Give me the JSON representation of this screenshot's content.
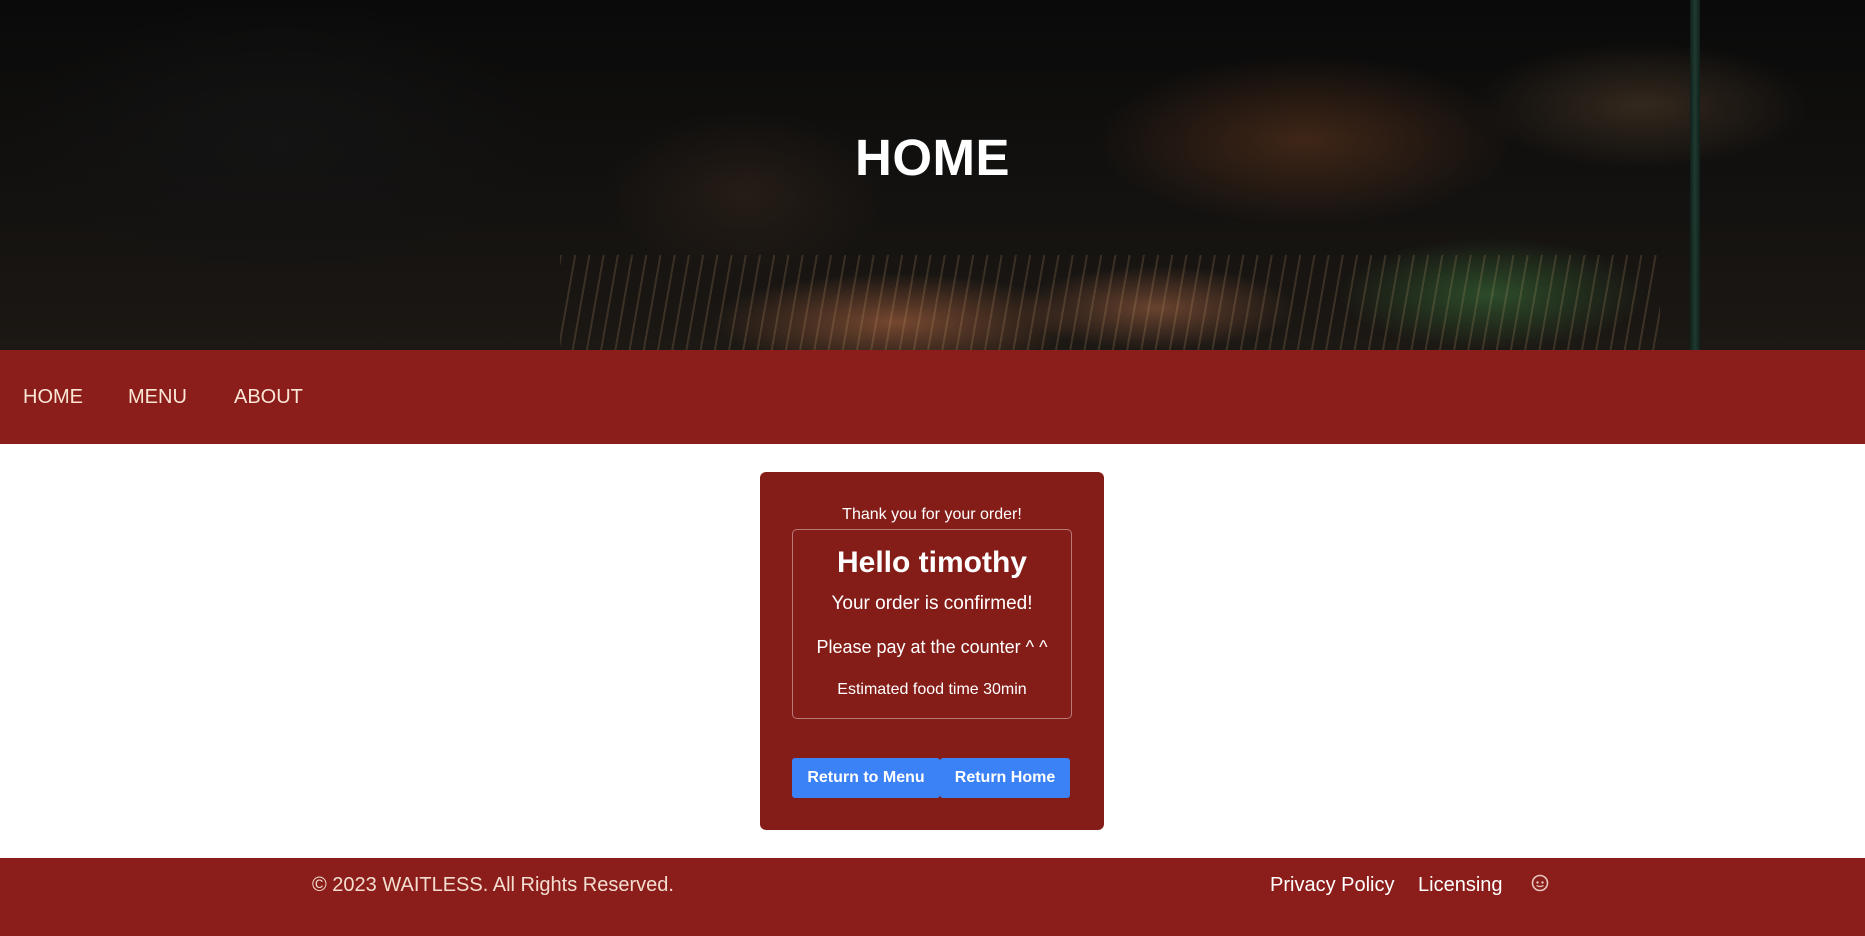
{
  "hero": {
    "title": "HOME"
  },
  "nav": {
    "items": [
      {
        "label": "HOME"
      },
      {
        "label": "MENU"
      },
      {
        "label": "ABOUT"
      }
    ]
  },
  "order": {
    "thanks": "Thank you for your order!",
    "greeting": "Hello timothy",
    "confirmed": "Your order is confirmed!",
    "pay_note": "Please pay at the counter ^ ^",
    "estimate": "Estimated food time 30min",
    "return_menu_label": "Return to Menu",
    "return_home_label": "Return Home"
  },
  "footer": {
    "copyright": "© 2023 WAITLESS. All Rights Reserved.",
    "privacy_label": "Privacy Policy",
    "licensing_label": "Licensing",
    "icon": "github-icon"
  },
  "colors": {
    "brand_red": "#8b1e1a",
    "card_red": "#841d18",
    "button_blue": "#3b82f6"
  }
}
